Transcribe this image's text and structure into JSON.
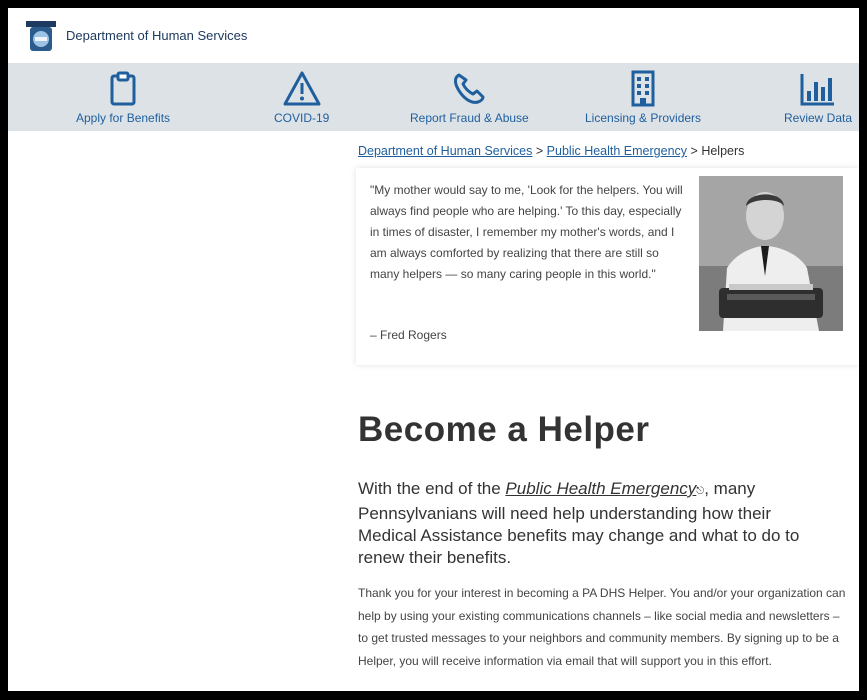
{
  "header": {
    "department": "Department of Human Services"
  },
  "nav": {
    "items": [
      {
        "label": "Apply for Benefits",
        "icon": "clipboard-icon"
      },
      {
        "label": "COVID-19",
        "icon": "warning-icon"
      },
      {
        "label": "Report Fraud & Abuse",
        "icon": "phone-icon"
      },
      {
        "label": "Licensing & Providers",
        "icon": "building-icon"
      },
      {
        "label": "Review Data",
        "icon": "bar-chart-icon"
      }
    ]
  },
  "breadcrumb": {
    "home": "Department of Human Services",
    "sep1": ">",
    "section": "Public Health Emergency",
    "sep2": ">",
    "current": "Helpers"
  },
  "quote": {
    "text": "\"My mother would say to me, 'Look for the helpers. You will always find people who are helping.' To this day, especially in times of disaster, I remember my mother's words, and I am always comforted by realizing that there are still so many helpers — so many caring people in this world.\"",
    "attribution": "– Fred Rogers"
  },
  "main": {
    "heading": "Become a Helper",
    "lead_before": "With the end of the ",
    "lead_link": "Public Health Emergency",
    "lead_after": ", many Pennsylvanians will need help understanding how their Medical Assistance benefits may change and what to do to renew their benefits.",
    "body": "Thank you for your interest in becoming a PA DHS Helper. You and/or your organization can help by using your existing communications channels – like social media and newsletters – to get trusted messages to your neighbors and community members. By signing up to be a Helper, you will receive information via email that will support you in this effort."
  },
  "colors": {
    "accent": "#1f5f9e",
    "navbar_bg": "#dde2e7",
    "text": "#333333"
  }
}
